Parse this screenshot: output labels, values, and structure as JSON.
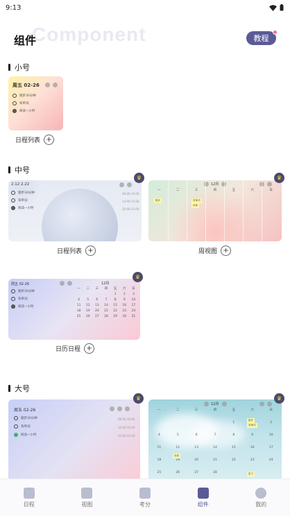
{
  "status": {
    "time": "9:13"
  },
  "header": {
    "title": "组件",
    "watermark": "Component",
    "tutorial": "教程"
  },
  "sections": {
    "small": "小号",
    "medium": "中号",
    "large": "大号"
  },
  "widgets": {
    "small_schedule": {
      "caption": "日程列表",
      "date": "周五 02-26",
      "items": [
        "跑步30分钟",
        "背单词",
        "阅读一小时"
      ]
    },
    "medium_schedule": {
      "caption": "日程列表",
      "date": "2.12 2.22",
      "items": [
        "跑步30分钟",
        "背单词",
        "阅读一小时"
      ],
      "times": [
        "09:00-10:00",
        "14:00-15:00",
        "20:00-21:00"
      ]
    },
    "medium_week": {
      "caption": "周视图",
      "month": "12月",
      "days": [
        "一",
        "二",
        "三",
        "四",
        "五",
        "六",
        "日"
      ],
      "chips": [
        "跑步",
        "背单词",
        "阅读"
      ]
    },
    "medium_calendar": {
      "caption": "日历日程",
      "date": "周五 02-26",
      "month": "12月",
      "items": [
        "跑步30分钟",
        "背单词",
        "阅读一小时"
      ],
      "weekdays": [
        "一",
        "二",
        "三",
        "四",
        "五",
        "六",
        "日"
      ],
      "days": [
        "",
        "",
        "",
        "",
        "1",
        "2",
        "3",
        "4",
        "5",
        "6",
        "7",
        "8",
        "9",
        "10",
        "11",
        "12",
        "13",
        "14",
        "15",
        "16",
        "17",
        "18",
        "19",
        "20",
        "21",
        "22",
        "23",
        "24",
        "25",
        "26",
        "27",
        "28",
        "29",
        "30",
        "31"
      ]
    },
    "large_schedule": {
      "date": "周五 02-26",
      "items": [
        "跑步30分钟",
        "背单词",
        "阅读一小时"
      ],
      "times": [
        "09:00-10:00",
        "14:00-15:00",
        "20:00-21:00"
      ]
    },
    "large_calendar": {
      "month": "12月",
      "weekdays": [
        "一",
        "二",
        "三",
        "四",
        "五",
        "六",
        "日"
      ],
      "days": [
        "",
        "",
        "",
        "",
        "1",
        "2",
        "3",
        "4",
        "5",
        "6",
        "7",
        "8",
        "9",
        "10",
        "11",
        "12",
        "13",
        "14",
        "15",
        "16",
        "17",
        "18",
        "19",
        "20",
        "21",
        "22",
        "23",
        "24",
        "25",
        "26",
        "27",
        "28"
      ],
      "chips": [
        "跑步",
        "背单词",
        "阅读",
        "复习"
      ]
    }
  },
  "nav": [
    {
      "label": "日程",
      "icon": "calendar-check-icon"
    },
    {
      "label": "视图",
      "icon": "grid-view-icon"
    },
    {
      "label": "考分",
      "icon": "chart-line-icon"
    },
    {
      "label": "组件",
      "icon": "cube-icon"
    },
    {
      "label": "我的",
      "icon": "avatar-icon"
    }
  ],
  "colors": {
    "accent": "#5b5a97",
    "badge": "#ff6b81",
    "crown": "#4a4c6a"
  }
}
